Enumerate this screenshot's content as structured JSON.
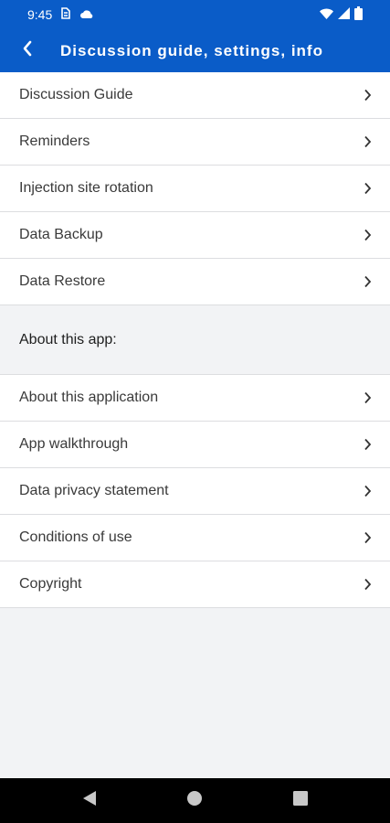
{
  "status_bar": {
    "time": "9:45",
    "icons_left": [
      "sim-icon",
      "cloud-icon"
    ],
    "icons_right": [
      "wifi-icon",
      "signal-icon",
      "battery-icon"
    ]
  },
  "app_bar": {
    "title": "Discussion guide, settings, info",
    "back_icon": "back-chevron-icon",
    "background_color": "#0a5cc8"
  },
  "settings": {
    "items": [
      {
        "label": "Discussion Guide"
      },
      {
        "label": "Reminders"
      },
      {
        "label": "Injection site rotation"
      },
      {
        "label": "Data Backup"
      },
      {
        "label": "Data Restore"
      }
    ]
  },
  "about": {
    "header": "About this app:",
    "items": [
      {
        "label": "About this application"
      },
      {
        "label": "App walkthrough"
      },
      {
        "label": "Data privacy statement"
      },
      {
        "label": "Conditions of use"
      },
      {
        "label": "Copyright"
      }
    ]
  },
  "nav_bar": {
    "buttons": [
      "back-triangle-icon",
      "home-circle-icon",
      "recents-square-icon"
    ]
  }
}
